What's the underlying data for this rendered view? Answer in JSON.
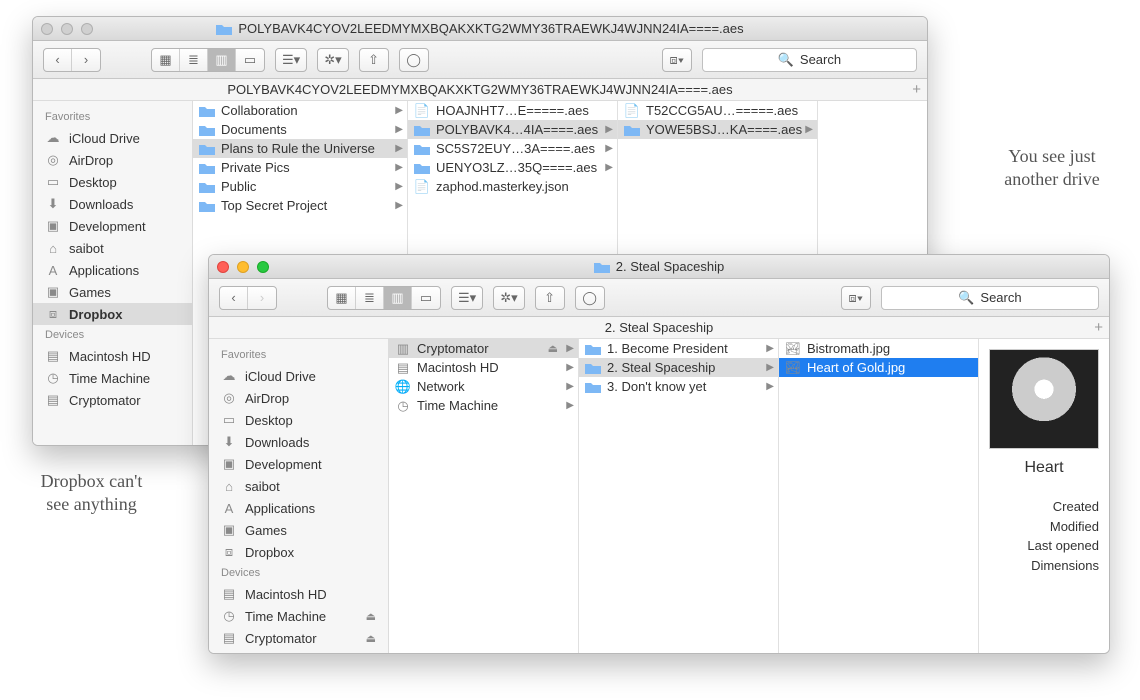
{
  "callouts": {
    "left": "Dropbox can't\nsee anything",
    "right": "You see just\nanother drive"
  },
  "win1": {
    "title": "POLYBAVK4CYOV2LEEDMYMXBQAKXKTG2WMY36TRAEWKJ4WJNN24IA====.aes",
    "path": "POLYBAVK4CYOV2LEEDMYMXBQAKXKTG2WMY36TRAEWKJ4WJNN24IA====.aes",
    "search_ph": "Search",
    "sidebar": {
      "s1": "Favorites",
      "items1": [
        "iCloud Drive",
        "AirDrop",
        "Desktop",
        "Downloads",
        "Development",
        "saibot",
        "Applications",
        "Games",
        "Dropbox"
      ],
      "s2": "Devices",
      "items2": [
        "Macintosh HD",
        "Time Machine",
        "Cryptomator"
      ]
    },
    "col1": [
      "Collaboration",
      "Documents",
      "Plans to Rule the Universe",
      "Private Pics",
      "Public",
      "Top Secret Project"
    ],
    "col2": [
      "HOAJNHT7…E=====.aes",
      "POLYBAVK4…4IA====.aes",
      "SC5S72EUY…3A====.aes",
      "UENYO3LZ…35Q====.aes",
      "zaphod.masterkey.json"
    ],
    "col3": [
      "T52CCG5AU…=====.aes",
      "YOWE5BSJ…KA====.aes"
    ]
  },
  "win2": {
    "title": "2. Steal Spaceship",
    "path": "2. Steal Spaceship",
    "search_ph": "Search",
    "sidebar": {
      "s1": "Favorites",
      "items1": [
        "iCloud Drive",
        "AirDrop",
        "Desktop",
        "Downloads",
        "Development",
        "saibot",
        "Applications",
        "Games",
        "Dropbox"
      ],
      "s2": "Devices",
      "items2": [
        "Macintosh HD",
        "Time Machine",
        "Cryptomator"
      ]
    },
    "col1": [
      "Cryptomator",
      "Macintosh HD",
      "Network",
      "Time Machine"
    ],
    "col2": [
      "1. Become President",
      "2. Steal Spaceship",
      "3. Don't know yet"
    ],
    "col3": [
      "Bistromath.jpg",
      "Heart of Gold.jpg"
    ],
    "preview": {
      "name": "Heart",
      "meta": [
        "Created",
        "Modified",
        "Last opened",
        "Dimensions"
      ]
    }
  }
}
